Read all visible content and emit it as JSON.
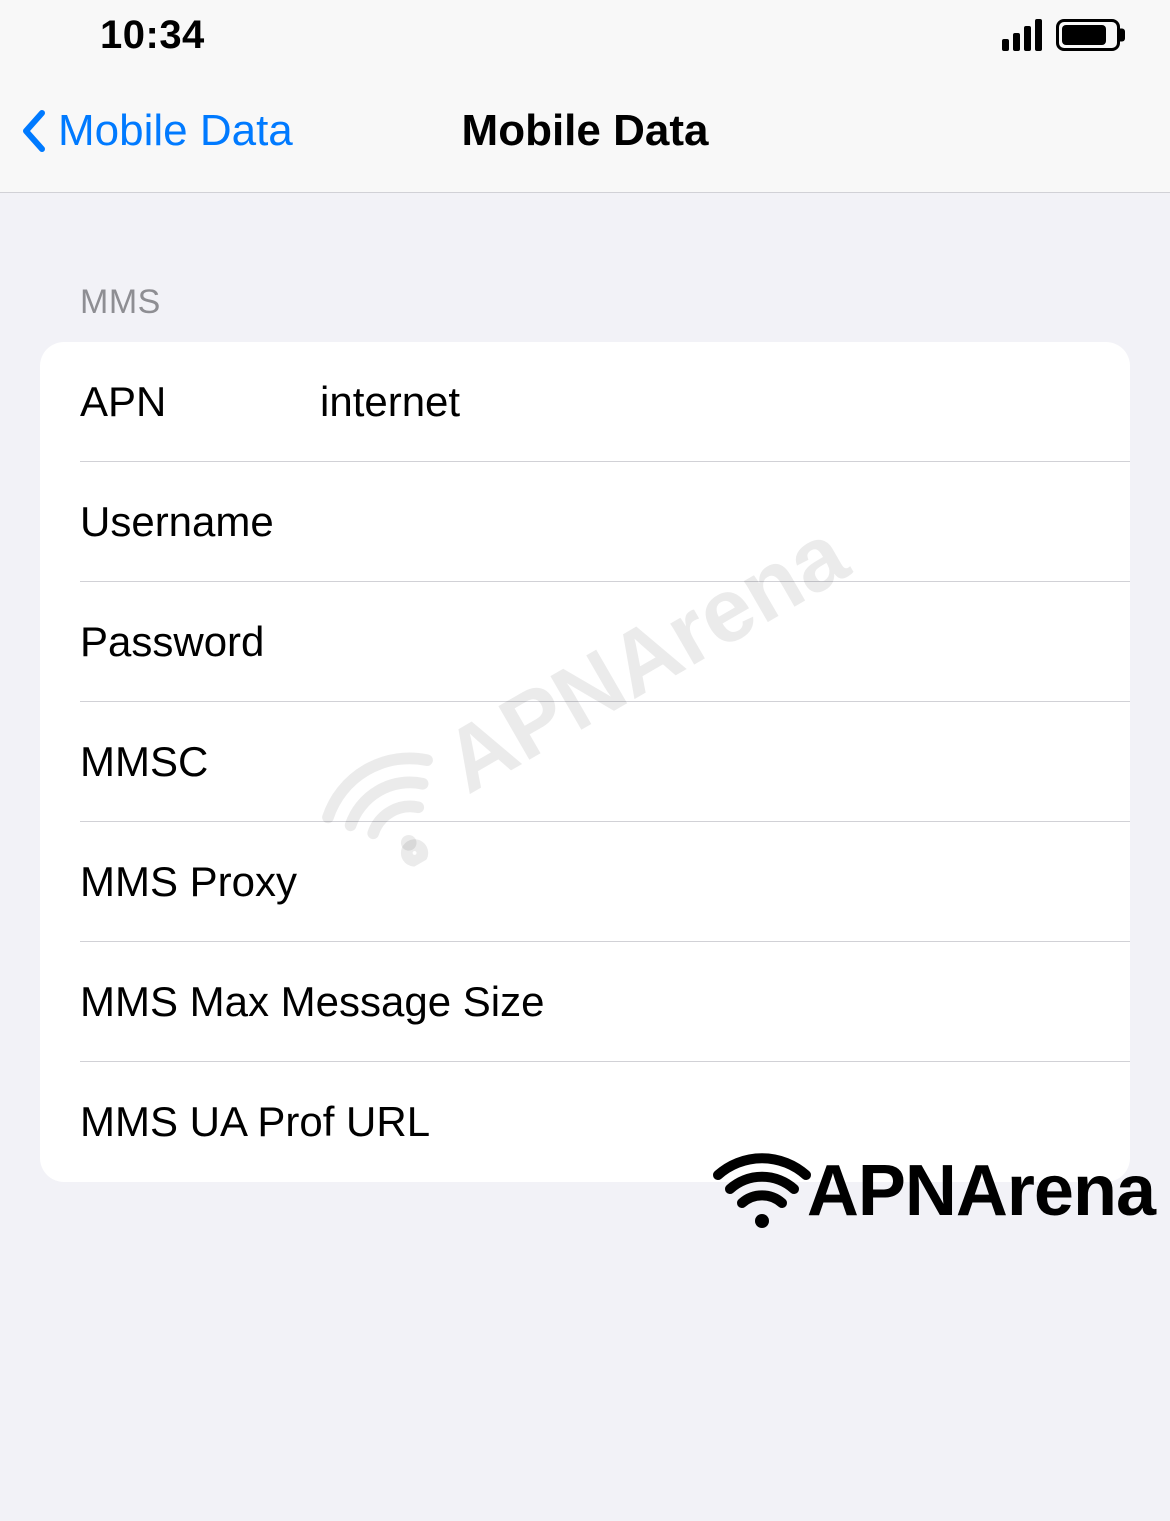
{
  "statusBar": {
    "time": "10:34"
  },
  "nav": {
    "backLabel": "Mobile Data",
    "title": "Mobile Data"
  },
  "section": {
    "header": "MMS"
  },
  "fields": {
    "apn": {
      "label": "APN",
      "value": "internet"
    },
    "username": {
      "label": "Username",
      "value": ""
    },
    "password": {
      "label": "Password",
      "value": ""
    },
    "mmsc": {
      "label": "MMSC",
      "value": ""
    },
    "mmsProxy": {
      "label": "MMS Proxy",
      "value": ""
    },
    "mmsMaxSize": {
      "label": "MMS Max Message Size",
      "value": ""
    },
    "mmsUaProfUrl": {
      "label": "MMS UA Prof URL",
      "value": ""
    }
  },
  "watermark": {
    "text": "APNArena"
  }
}
